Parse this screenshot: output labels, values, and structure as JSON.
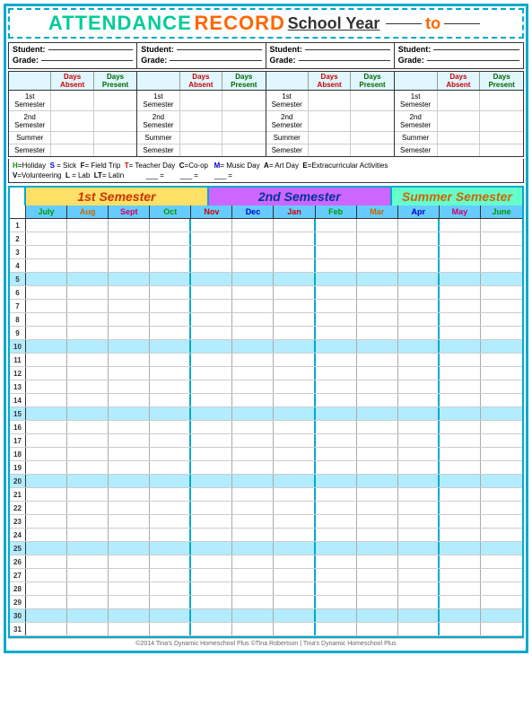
{
  "title": {
    "attendance": "ATTENDANCE",
    "record": "RECORD",
    "school": "School Year",
    "to": "to"
  },
  "students": [
    {
      "label_student": "Student:",
      "label_grade": "Grade:"
    },
    {
      "label_student": "Student:",
      "label_grade": "Grade:"
    },
    {
      "label_student": "Student:",
      "label_grade": "Grade:"
    },
    {
      "label_student": "Student:",
      "label_grade": "Grade:"
    }
  ],
  "summary": {
    "col_headers": [
      "",
      "Days Absent",
      "Days Present"
    ],
    "rows": [
      "1st Semester",
      "2nd Semester",
      "Summer",
      "Semester"
    ]
  },
  "legend": {
    "line1": "H=Holiday  S = Sick  F= Field Trip  T= Teacher Day  C=Co-op   M= Music Day  A= Art Day  E=Extracurricular Activities",
    "line2": "V=Volunteering  L = Lab  LT= Latin            =           =           ="
  },
  "semesters": {
    "sem1": "1st Semester",
    "sem2": "2nd Semester",
    "summer": "Summer Semester"
  },
  "months": [
    "July",
    "Aug",
    "Sept",
    "Oct",
    "Nov",
    "Dec",
    "Jan",
    "Feb",
    "Mar",
    "Apr",
    "May",
    "June"
  ],
  "days": [
    1,
    2,
    3,
    4,
    5,
    6,
    7,
    8,
    9,
    10,
    11,
    12,
    13,
    14,
    15,
    16,
    17,
    18,
    19,
    20,
    21,
    22,
    23,
    24,
    25,
    26,
    27,
    28,
    29,
    30,
    31
  ],
  "highlight_rows": [
    5,
    10,
    15,
    20,
    25,
    30
  ],
  "copyright": "©2014 Tina's Dynamic Homeschool Plus                    ©Tina Robertson | Tina's Dynamic Homeschool Plus"
}
